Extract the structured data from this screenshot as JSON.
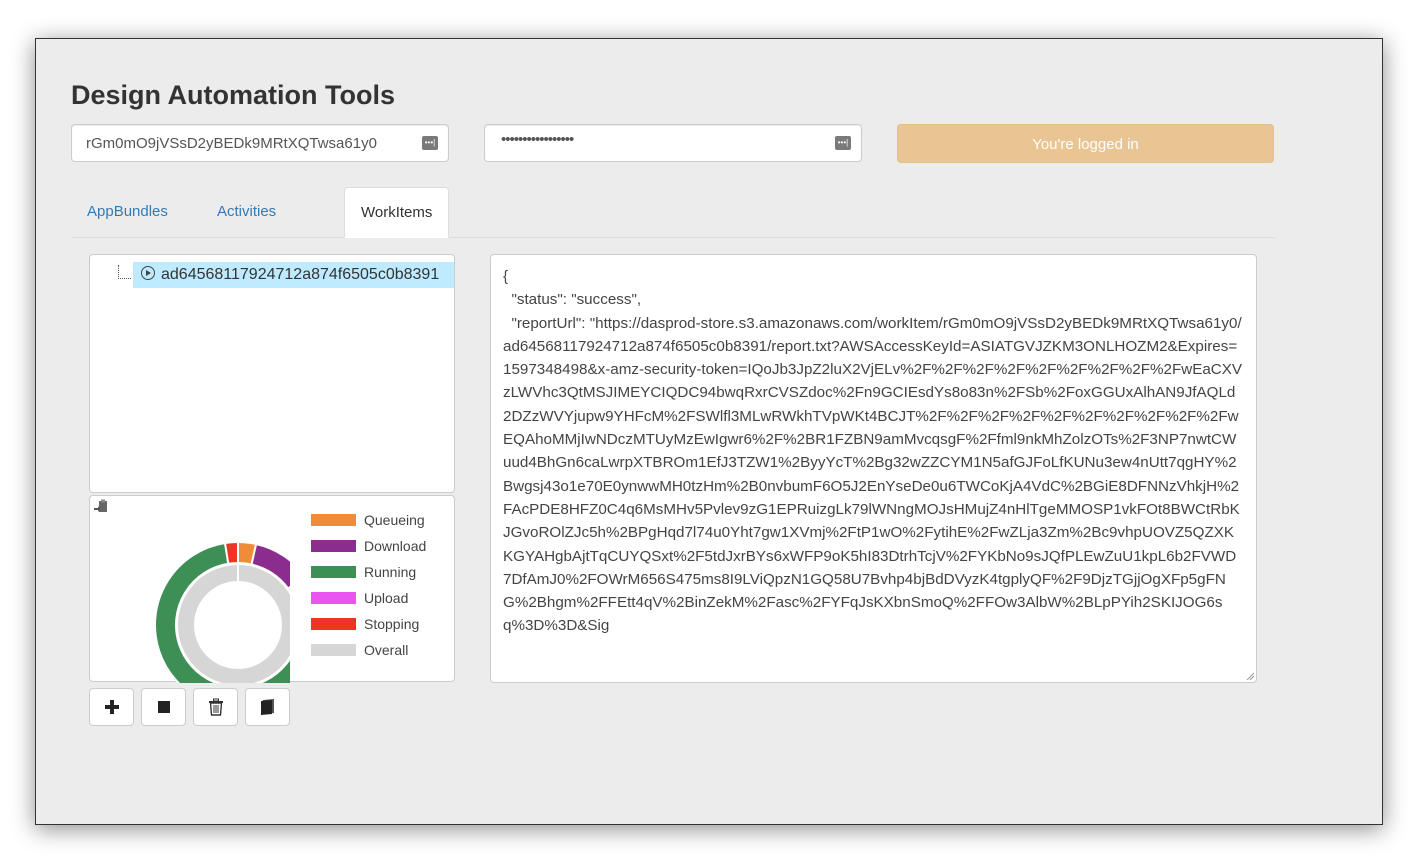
{
  "app": {
    "title": "Design Automation Tools"
  },
  "login": {
    "client_id_value": "rGm0mO9jVSsD2yBEDk9MRtXQTwsa61y0",
    "client_secret_masked": "•••••••••••••••••",
    "key_icon": "password-manager-icon",
    "status_button_label": "You're logged in",
    "status_color": "#e8c592"
  },
  "tabs": [
    {
      "label": "AppBundles",
      "active": false
    },
    {
      "label": "Activities",
      "active": false
    },
    {
      "label": "WorkItems",
      "active": true
    }
  ],
  "tree": {
    "items": [
      {
        "label": "ad64568117924712a874f6505c0b8391",
        "icon": "play-circle-icon",
        "selected": true
      }
    ]
  },
  "chart_data": {
    "type": "pie",
    "variant": "nested-donut",
    "title": "",
    "series": [
      {
        "name": "outer",
        "categories": [
          "Queueing",
          "Download",
          "Running",
          "Upload",
          "Stopping"
        ],
        "values": [
          3.5,
          11.5,
          82.5,
          0,
          2.5
        ],
        "colors": [
          "#f08c38",
          "#8a2d8e",
          "#3d8f55",
          "#ea55f0",
          "#ee3523"
        ]
      },
      {
        "name": "inner",
        "categories": [
          "Overall"
        ],
        "values": [
          100
        ],
        "colors": [
          "#d6d6d6"
        ]
      }
    ],
    "legend": {
      "placement": "right",
      "entries": [
        {
          "label": "Queueing",
          "color": "#f08c38"
        },
        {
          "label": "Download",
          "color": "#8a2d8e"
        },
        {
          "label": "Running",
          "color": "#3d8f55"
        },
        {
          "label": "Upload",
          "color": "#ea55f0"
        },
        {
          "label": "Stopping",
          "color": "#ee3523"
        },
        {
          "label": "Overall",
          "color": "#d6d6d6"
        }
      ]
    }
  },
  "toolbar": {
    "buttons": [
      {
        "name": "add",
        "icon": "plus-icon"
      },
      {
        "name": "stop",
        "icon": "stop-icon"
      },
      {
        "name": "delete",
        "icon": "trash-icon"
      },
      {
        "name": "book",
        "icon": "book-icon"
      }
    ]
  },
  "result": {
    "text": "{\n  \"status\": \"success\",\n  \"reportUrl\": \"https://dasprod-store.s3.amazonaws.com/workItem/rGm0mO9jVSsD2yBEDk9MRtXQTwsa61y0/ad64568117924712a874f6505c0b8391/report.txt?AWSAccessKeyId=ASIATGVJZKM3ONLHOZM2&Expires=1597348498&x-amz-security-token=IQoJb3JpZ2luX2VjELv%2F%2F%2F%2F%2F%2F%2F%2F%2FwEaCXVzLWVhc3QtMSJIMEYCIQDC94bwqRxrCVSZdoc%2Fn9GCIEsdYs8o83n%2FSb%2FoxGGUxAlhAN9JfAQLd2DZzWVYjupw9YHFcM%2FSWlfl3MLwRWkhTVpWKt4BCJT%2F%2F%2F%2F%2F%2F%2F%2F%2F%2FwEQAhoMMjIwNDczMTUyMzEwIgwr6%2F%2BR1FZBN9amMvcqsgF%2Ffml9nkMhZolzOTs%2F3NP7nwtCWuud4BhGn6caLwrpXTBROm1EfJ3TZW1%2ByyYcT%2Bg32wZZCYM1N5afGJFoLfKUNu3ew4nUtt7qgHY%2Bwgsj43o1e70E0ynwwMH0tzHm%2B0nvbumF6O5J2EnYseDe0u6TWCoKjA4VdC%2BGiE8DFNNzVhkjH%2FAcPDE8HFZ0C4q6MsMHv5Pvlev9zG1EPRuizgLk79lWNngMOJsHMujZ4nHlTgeMMOSP1vkFOt8BWCtRbKJGvoROlZJc5h%2BPgHqd7l74u0Yht7gw1XVmj%2FtP1wO%2FytihE%2FwZLja3Zm%2Bc9vhpUOVZ5QZXKKGYAHgbAjtTqCUYQSxt%2F5tdJxrBYs6xWFP9oK5hI83DtrhTcjV%2FYKbNo9sJQfPLEwZuU1kpL6b2FVWD7DfAmJ0%2FOWrM656S475ms8I9LViQpzN1GQ58U7Bvhp4bjBdDVyzK4tgplyQF%2F9DjzTGjjOgXFp5gFNG%2Bhgm%2FFEtt4qV%2BinZekM%2Fasc%2FYFqJsKXbnSmoQ%2FFOw3AlbW%2BLpPYih2SKIJOG6sq%3D%3D&Sig"
  }
}
